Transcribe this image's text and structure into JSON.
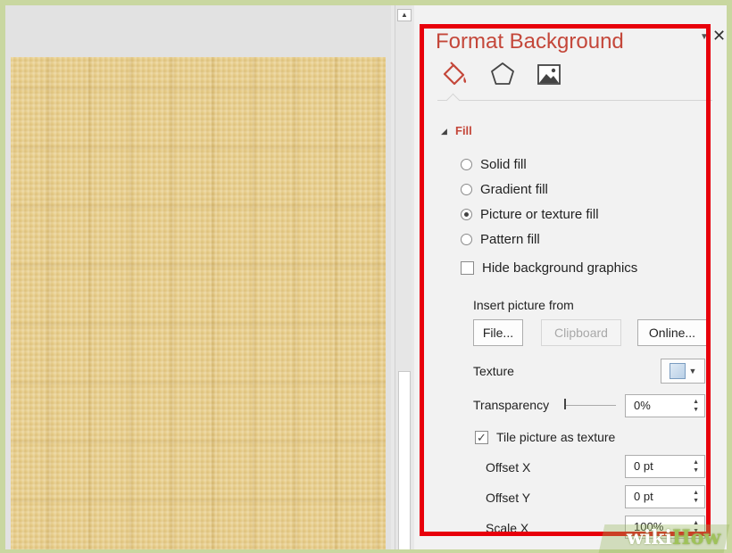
{
  "pane": {
    "title": "Format Background"
  },
  "tabs": [
    {
      "name": "fill",
      "icon": "paint-bucket-icon"
    },
    {
      "name": "effects",
      "icon": "pentagon-icon"
    },
    {
      "name": "picture",
      "icon": "picture-icon"
    }
  ],
  "fill": {
    "section_title": "Fill",
    "options": [
      {
        "label": "Solid fill",
        "selected": false
      },
      {
        "label": "Gradient fill",
        "selected": false
      },
      {
        "label": "Picture or texture fill",
        "selected": true
      },
      {
        "label": "Pattern fill",
        "selected": false
      }
    ],
    "hide_background": {
      "label": "Hide background graphics",
      "checked": false
    },
    "insert_picture_label": "Insert picture from",
    "buttons": {
      "file": "File...",
      "clipboard": "Clipboard",
      "online": "Online..."
    },
    "texture_label": "Texture",
    "transparency": {
      "label": "Transparency",
      "value": "0%"
    },
    "tile": {
      "label": "Tile picture as texture",
      "checked": true
    },
    "offset_x": {
      "label": "Offset X",
      "value": "0 pt"
    },
    "offset_y": {
      "label": "Offset Y",
      "value": "0 pt"
    },
    "scale_x": {
      "label": "Scale X",
      "value": "100%"
    }
  },
  "watermark": {
    "part1": "wiki",
    "part2": "How"
  },
  "colors": {
    "accent": "#c4473a",
    "highlight": "#e8000b",
    "slide": "#e9cf8c"
  }
}
